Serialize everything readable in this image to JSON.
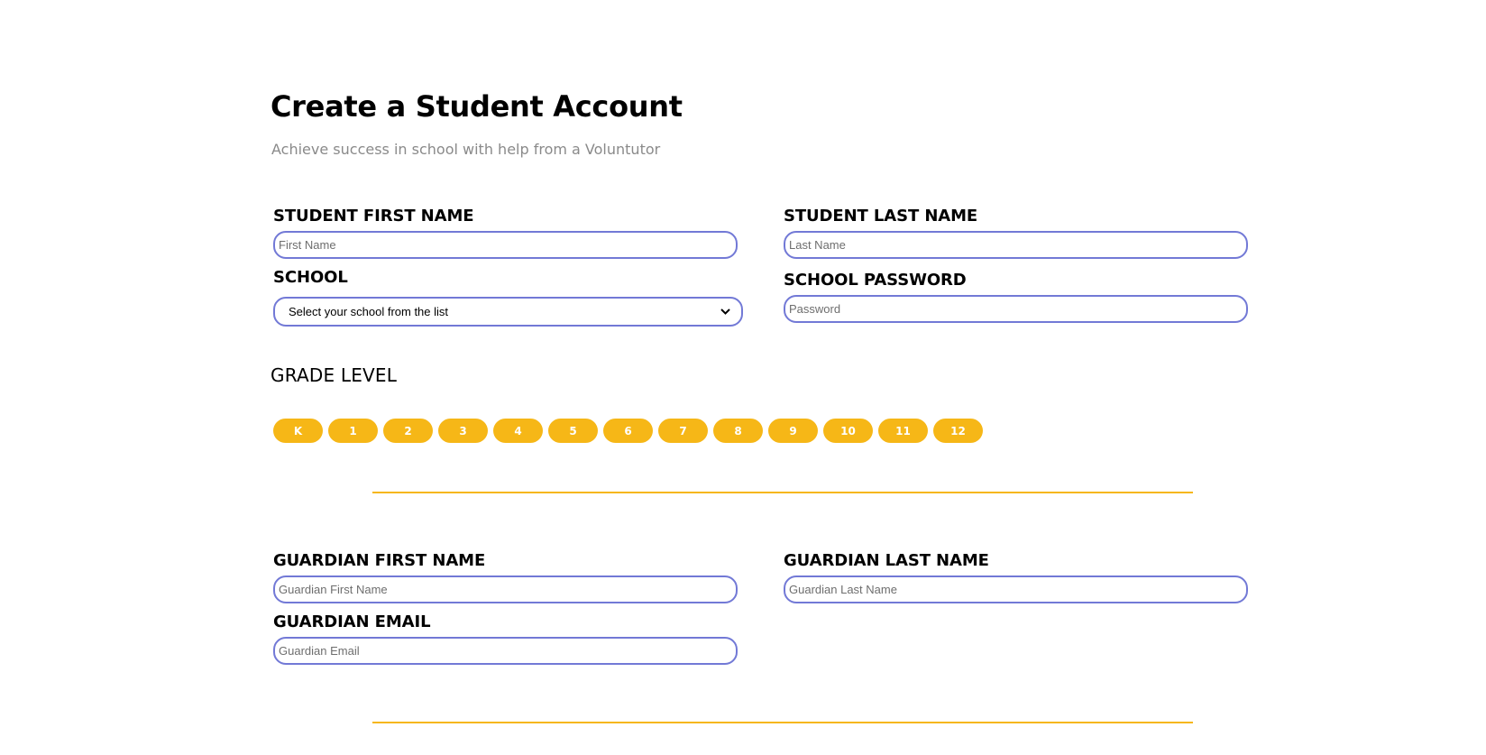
{
  "header": {
    "title": "Create a Student Account",
    "subtitle": "Achieve success in school with help from a Voluntutor"
  },
  "student": {
    "first_name_label": "STUDENT FIRST NAME",
    "first_name_placeholder": "First Name",
    "last_name_label": "STUDENT LAST NAME",
    "last_name_placeholder": "Last Name",
    "school_label": "SCHOOL",
    "school_selected": "Select your school from the list",
    "password_label": "SCHOOL PASSWORD",
    "password_placeholder": "Password"
  },
  "grade": {
    "heading": "GRADE LEVEL",
    "levels": [
      "K",
      "1",
      "2",
      "3",
      "4",
      "5",
      "6",
      "7",
      "8",
      "9",
      "10",
      "11",
      "12"
    ]
  },
  "guardian": {
    "first_name_label": "GUARDIAN FIRST NAME",
    "first_name_placeholder": "Guardian First Name",
    "last_name_label": "GUARDIAN LAST NAME",
    "last_name_placeholder": "Guardian Last Name",
    "email_label": "GUARDIAN EMAIL",
    "email_placeholder": "Guardian Email"
  },
  "icons": {
    "select_arrow": "chevron-down-icon"
  },
  "colors": {
    "accent": "#f6b717",
    "input_border": "#7279d6",
    "subtitle": "#8a8a8a",
    "divider": "#f6b717"
  }
}
